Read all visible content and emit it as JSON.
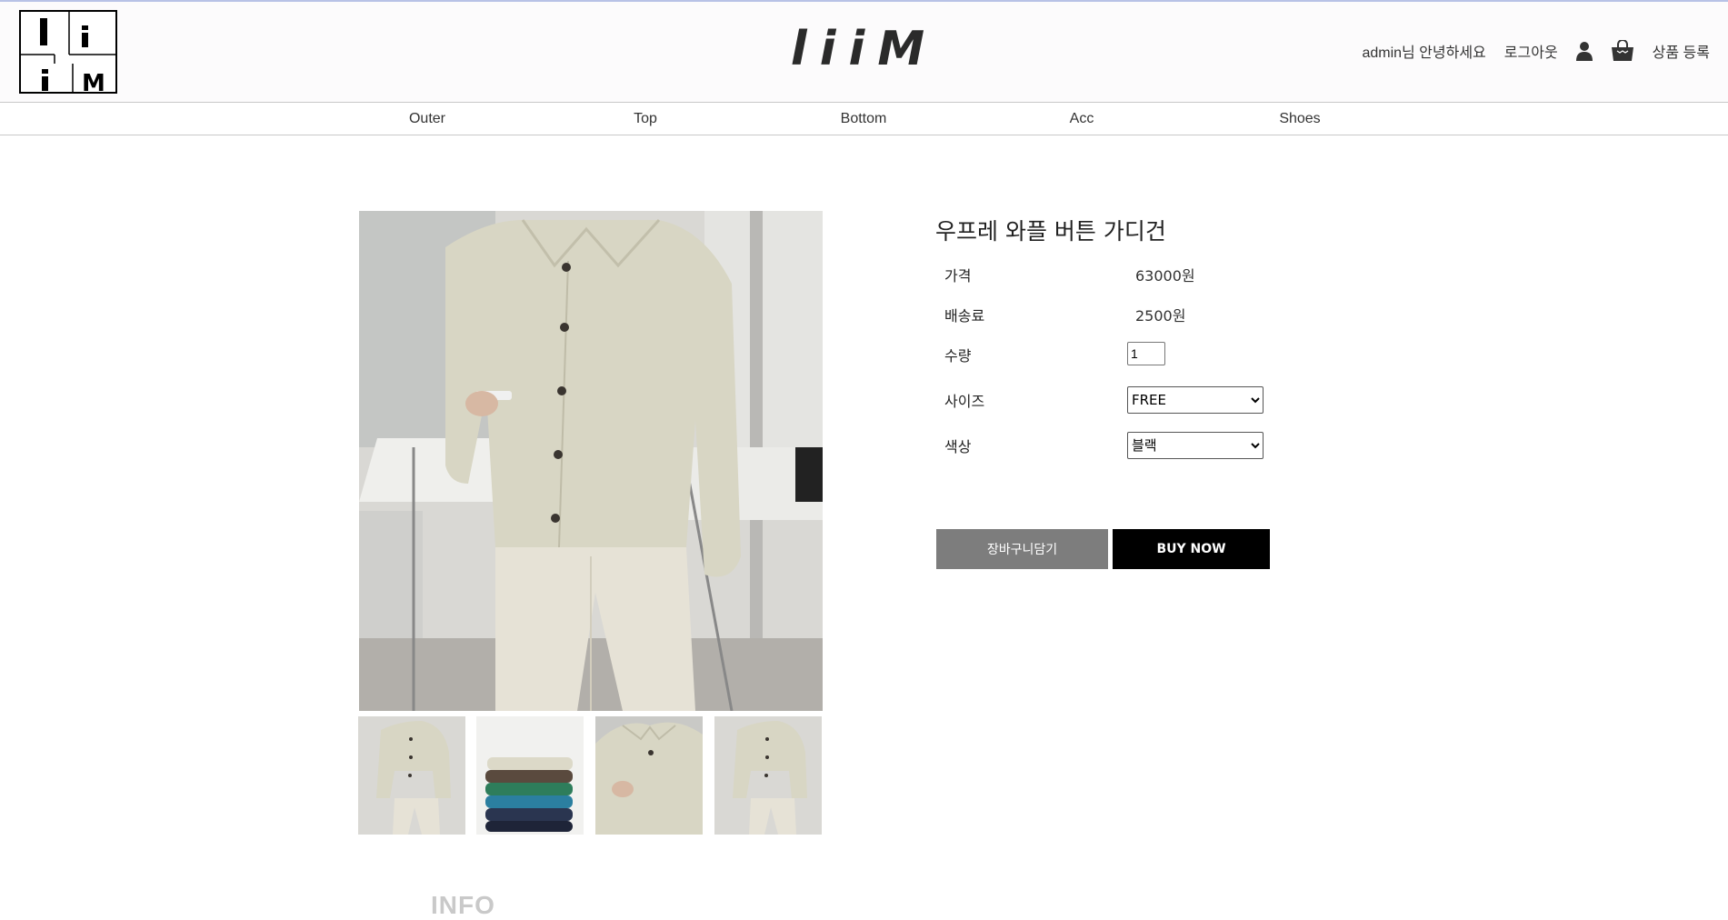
{
  "header": {
    "brand": "liiM",
    "logo_text": "liiM",
    "greeting": "admin님 안녕하세요",
    "logout": "로그아웃",
    "register": "상품 등록",
    "icons": [
      "user-icon",
      "shopping-bag-icon"
    ]
  },
  "nav": {
    "items": [
      {
        "label": "Outer"
      },
      {
        "label": "Top"
      },
      {
        "label": "Bottom"
      },
      {
        "label": "Acc"
      },
      {
        "label": "Shoes"
      }
    ]
  },
  "product": {
    "name": "우프레 와플 버튼 가디건",
    "price_label": "가격",
    "price": "63000원",
    "shipping_label": "배송료",
    "shipping": "2500원",
    "qty_label": "수량",
    "qty": "1",
    "size_label": "사이즈",
    "size": "FREE",
    "color_label": "색상",
    "color": "블랙",
    "add_to_cart": "장바구니담기",
    "buy_now": "BUY NOW"
  },
  "info": {
    "heading": "INFO"
  },
  "colors": {
    "cardigan": "#d8d6c4",
    "cart_button": "#7d7d7d",
    "buy_button": "#000000",
    "topline": "#b8c2e6"
  }
}
